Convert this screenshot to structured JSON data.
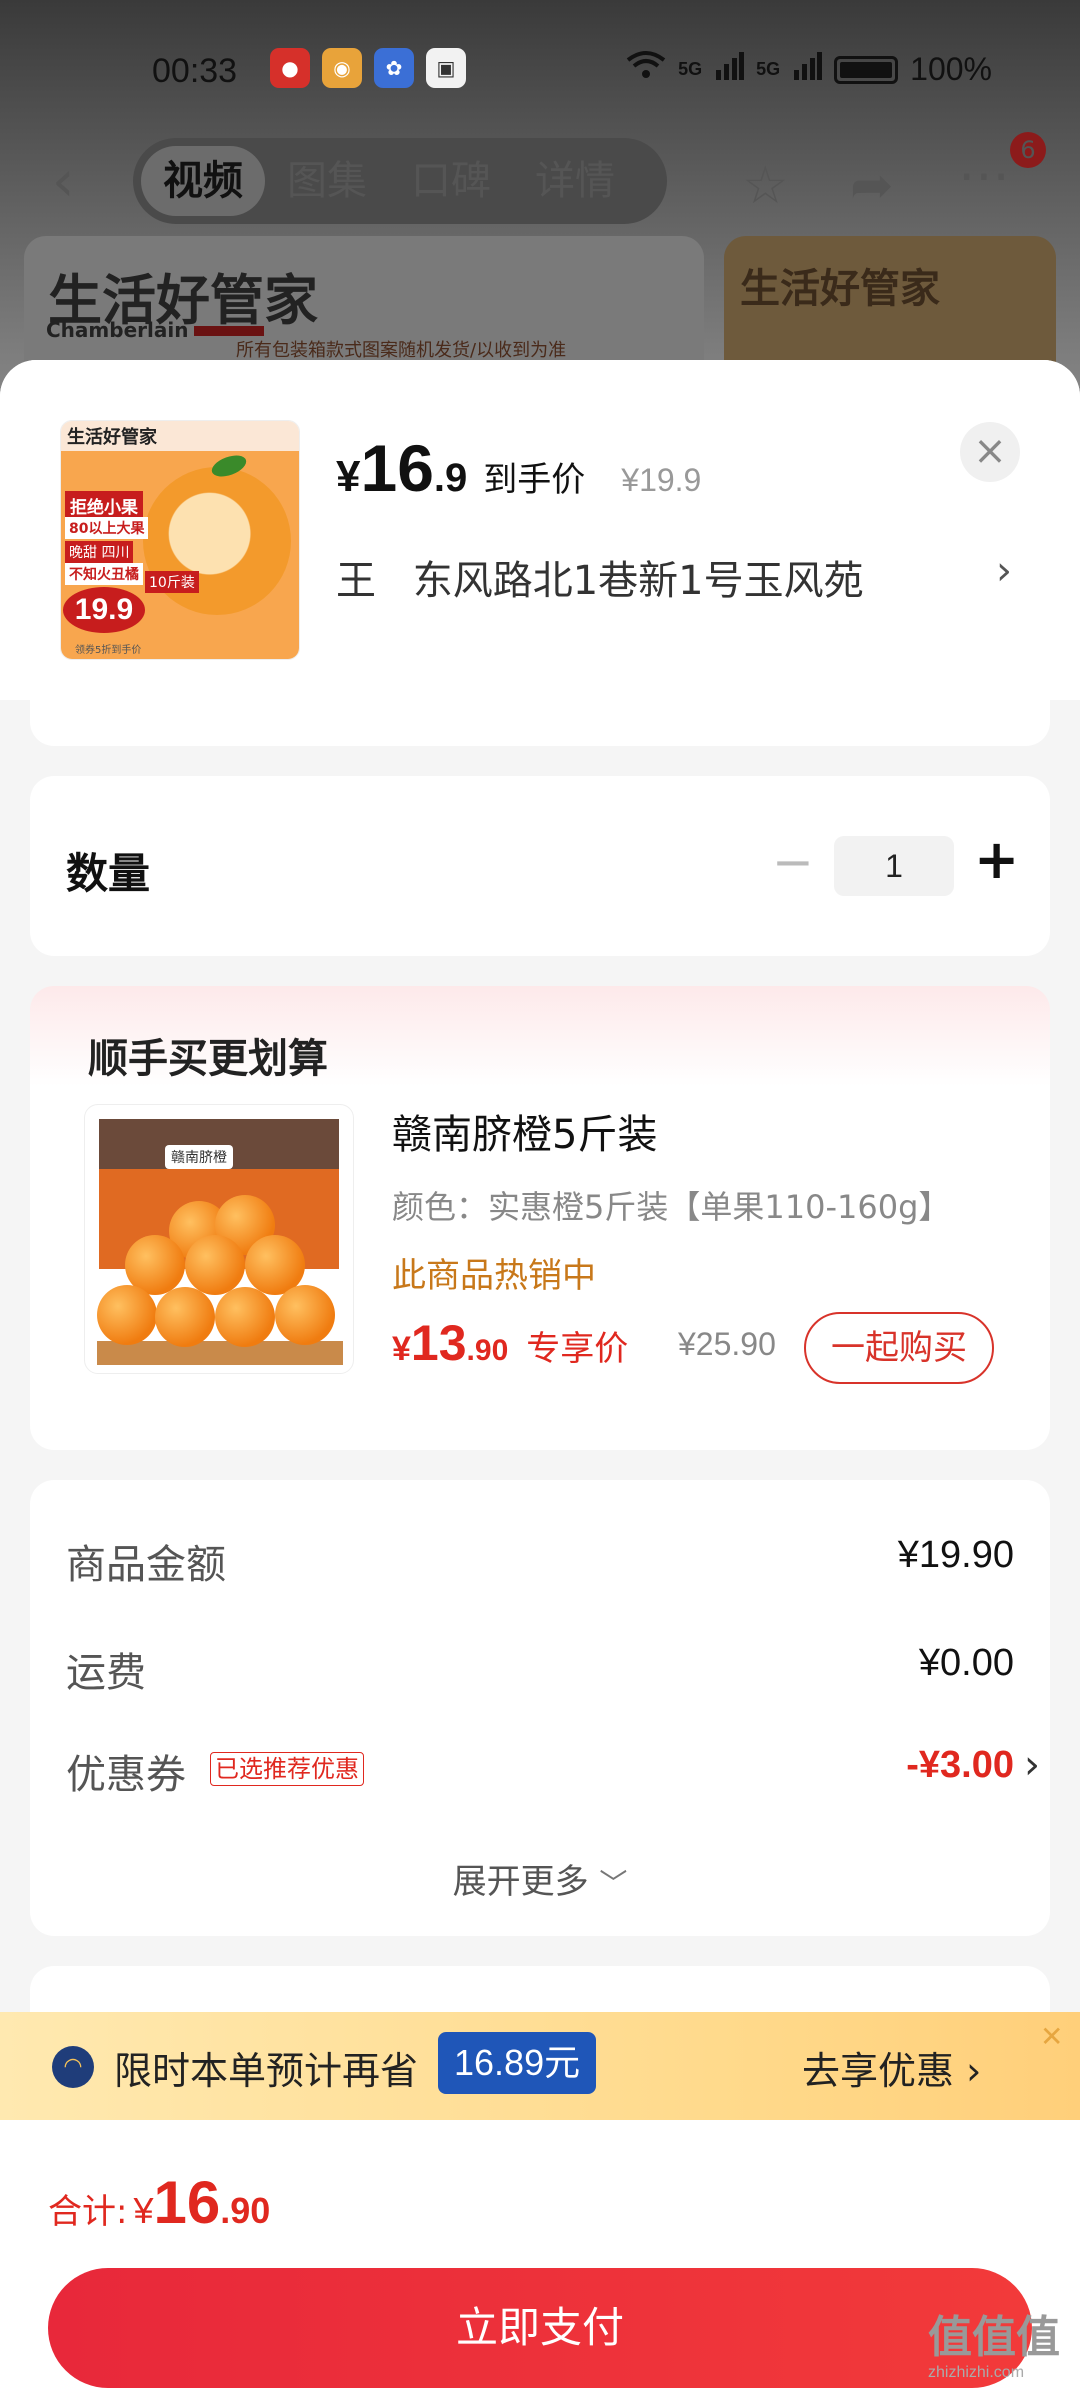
{
  "status_bar": {
    "time": "00:33",
    "network_1": "5G",
    "network_2": "5G",
    "battery": "100%",
    "app_icons": [
      "jd-app-icon",
      "weibo-app-icon",
      "baidu-app-icon",
      "realme-app-icon"
    ]
  },
  "nav": {
    "tabs": [
      "视频",
      "图集",
      "口碑",
      "详情"
    ],
    "active_tab": "视频",
    "badge_count": "6"
  },
  "banner": {
    "brand": "生活好管家",
    "brand_en": "Chamberlain",
    "note": "所有包装箱款式图案随机发货/以收到为准"
  },
  "product": {
    "price_int": "16",
    "price_dec": ".9",
    "price_label": "到手价",
    "original_price": "¥19.9",
    "thumb": {
      "brand": "生活好管家",
      "tag1": "拒绝小果",
      "tag2": "80以上大果",
      "tag3": "晚甜 四川",
      "tag4": "不知火丑橘",
      "spec": "10斤装",
      "price": "19.9",
      "sub": "领券5折到手价"
    }
  },
  "address": {
    "name": "王",
    "detail": "东风路北1巷新1号玉风苑"
  },
  "quantity": {
    "label": "数量",
    "value": "1"
  },
  "bundle": {
    "title": "顺手买更划算",
    "name": "赣南脐橙5斤装",
    "spec": "颜色：实惠橙5斤装【单果110-160g】",
    "hot": "此商品热销中",
    "price_int": "13",
    "price_dec": ".90",
    "price_label": "专享价",
    "original_price": "¥25.90",
    "button": "一起购买",
    "box_label": "赣南脐橙"
  },
  "summary": {
    "goods_label": "商品金额",
    "goods_value": "¥19.90",
    "shipping_label": "运费",
    "shipping_value": "¥0.00",
    "coupon_label": "优惠券",
    "coupon_tag": "已选推荐优惠",
    "coupon_value": "-¥3.00",
    "expand": "展开更多"
  },
  "promo": {
    "text": "限时本单预计再省",
    "amount": "16.89元",
    "cta": "去享优惠"
  },
  "footer": {
    "total_label": "合计:",
    "total_int": "16",
    "total_dec": ".90",
    "pay_button": "立即支付"
  },
  "watermark": {
    "main": "值值值",
    "sub": "zhizhizhi.com"
  },
  "colors": {
    "accent_red": "#e0281f",
    "pay_button": "#f23a3a",
    "hot_orange": "#c8781a",
    "promo_blue": "#1f56b8"
  }
}
